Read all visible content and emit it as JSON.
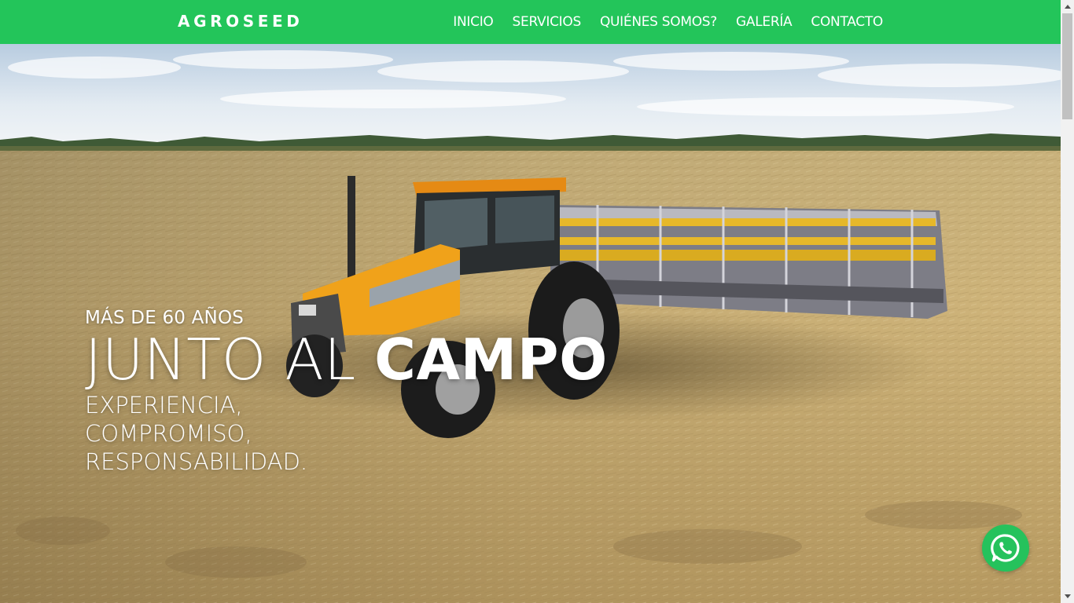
{
  "header": {
    "brand": "AGROSEED",
    "nav": [
      {
        "label": "INICIO"
      },
      {
        "label": "SERVICIOS"
      },
      {
        "label": "QUIÉNES SOMOS?"
      },
      {
        "label": "GALERÍA"
      },
      {
        "label": "CONTACTO"
      }
    ]
  },
  "hero": {
    "eyebrow": "MÁS DE 60 AÑOS",
    "headline_thin": "JUNTO AL ",
    "headline_bold": "CAMPO",
    "tagline_lines": [
      "EXPERIENCIA,",
      "COMPROMISO,",
      "RESPONSABILIDAD."
    ]
  },
  "floating": {
    "icon": "whatsapp-icon"
  },
  "colors": {
    "header_bg": "#23c55a",
    "whatsapp_bg": "#25c25c",
    "text": "#ffffff"
  }
}
